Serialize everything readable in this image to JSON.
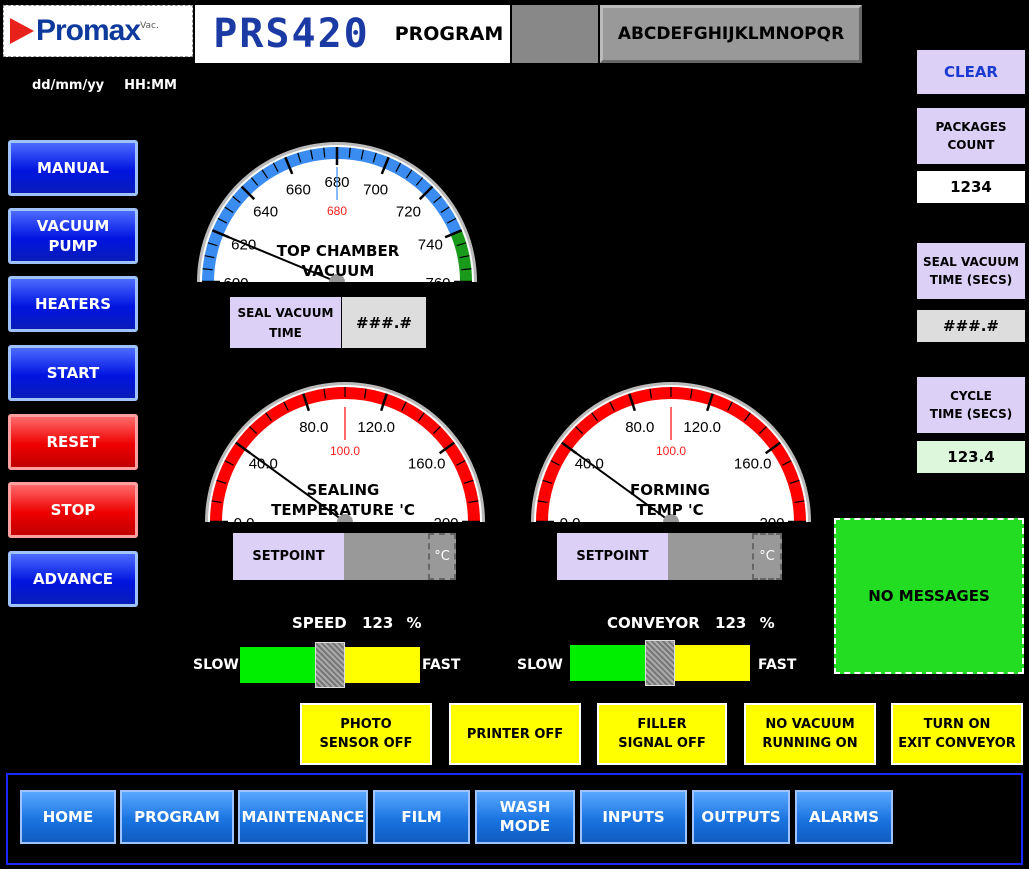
{
  "header": {
    "logo_text": "Promax",
    "logo_sub": "Vac.",
    "model": "PRS420",
    "screen_name": "PROGRAM",
    "product_name": "ABCDEFGHIJKLMNOPQR"
  },
  "datetime": {
    "date": "dd/mm/yy",
    "time": "HH:MM"
  },
  "sidebar": {
    "items": [
      {
        "label": "MANUAL"
      },
      {
        "label": "VACUUM\nPUMP"
      },
      {
        "label": "HEATERS"
      },
      {
        "label": "START"
      },
      {
        "label": "RESET"
      },
      {
        "label": "STOP"
      },
      {
        "label": "ADVANCE"
      }
    ]
  },
  "right_panel": {
    "clear_label": "CLEAR",
    "packages_label": "PACKAGES\nCOUNT",
    "packages_value": "1234",
    "seal_vacuum_label": "SEAL VACUUM\nTIME (SECS)",
    "seal_vacuum_value": "###.#",
    "cycle_label": "CYCLE\nTIME (SECS)",
    "cycle_value": "123.4"
  },
  "gauges": {
    "vacuum": {
      "title": "TOP CHAMBER\nVACUUM",
      "ticks": [
        "600",
        "620",
        "640",
        "660",
        "680",
        "700",
        "720",
        "740",
        "760"
      ],
      "readout": "680",
      "value": 620,
      "range": [
        600,
        760
      ],
      "seal_label": "SEAL VACUUM\nTIME",
      "seal_value": "###.#",
      "arc_color": "#3a8cf0",
      "band_color": "#1a9a1a"
    },
    "sealing": {
      "title": "SEALING\nTEMPERATURE 'C",
      "ticks": [
        "0.0",
        "40.0",
        "80.0",
        "120.0",
        "160.0",
        "200"
      ],
      "readout": "100.0",
      "value": 40,
      "range": [
        0,
        200
      ],
      "setpoint_label": "SETPOINT",
      "unit": "°C",
      "arc_color": "#ff0000"
    },
    "forming": {
      "title": "FORMING\nTEMP 'C",
      "ticks": [
        "0.0",
        "40.0",
        "80.0",
        "120.0",
        "160.0",
        "200"
      ],
      "readout": "100.0",
      "value": 40,
      "range": [
        0,
        200
      ],
      "setpoint_label": "SETPOINT",
      "unit": "°C",
      "arc_color": "#ff0000"
    }
  },
  "sliders": {
    "speed": {
      "label": "SPEED",
      "value": "123",
      "unit": "%",
      "slow": "SLOW",
      "fast": "FAST",
      "position": 0.5
    },
    "conveyor": {
      "label": "CONVEYOR",
      "value": "123",
      "unit": "%",
      "slow": "SLOW",
      "fast": "FAST",
      "position": 0.5
    }
  },
  "message": "NO MESSAGES",
  "status_buttons": [
    {
      "label": "PHOTO\nSENSOR OFF"
    },
    {
      "label": "PRINTER OFF"
    },
    {
      "label": "FILLER\nSIGNAL OFF"
    },
    {
      "label": "NO VACUUM\nRUNNING ON"
    },
    {
      "label": "TURN ON\nEXIT CONVEYOR"
    }
  ],
  "nav": {
    "items": [
      {
        "label": "HOME"
      },
      {
        "label": "PROGRAM"
      },
      {
        "label": "MAINTENANCE"
      },
      {
        "label": "FILM"
      },
      {
        "label": "WASH\nMODE"
      },
      {
        "label": "INPUTS"
      },
      {
        "label": "OUTPUTS"
      },
      {
        "label": "ALARMS"
      }
    ]
  }
}
